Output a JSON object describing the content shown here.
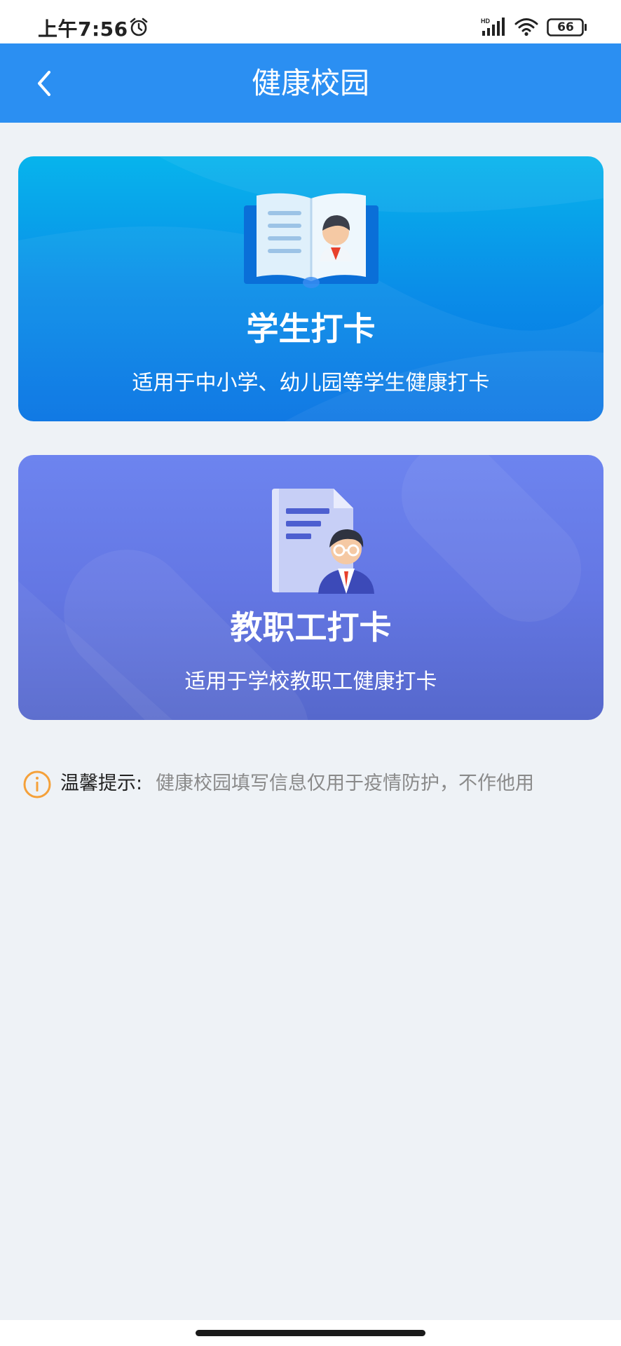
{
  "status_bar": {
    "time": "上午7:56",
    "battery": "66",
    "icons": [
      "alarm-icon",
      "hd-signal-icon",
      "wifi-icon",
      "battery-icon"
    ]
  },
  "nav": {
    "title": "健康校园",
    "back_icon": "chevron-left-icon"
  },
  "cards": [
    {
      "title": "学生打卡",
      "description": "适用于中小学、幼儿园等学生健康打卡",
      "illustration": "open-book-student-icon"
    },
    {
      "title": "教职工打卡",
      "description": "适用于学校教职工健康打卡",
      "illustration": "document-teacher-icon"
    }
  ],
  "tip": {
    "label": "温馨提示:",
    "text": "健康校园填写信息仅用于疫情防护，不作他用",
    "icon": "info-circle-icon"
  },
  "colors": {
    "nav_bar": "#2b8ff2",
    "student_card": "#0a8ee8",
    "staff_card": "#6477e4",
    "tip_icon": "#f5a13a",
    "page_background": "#eef2f6"
  }
}
